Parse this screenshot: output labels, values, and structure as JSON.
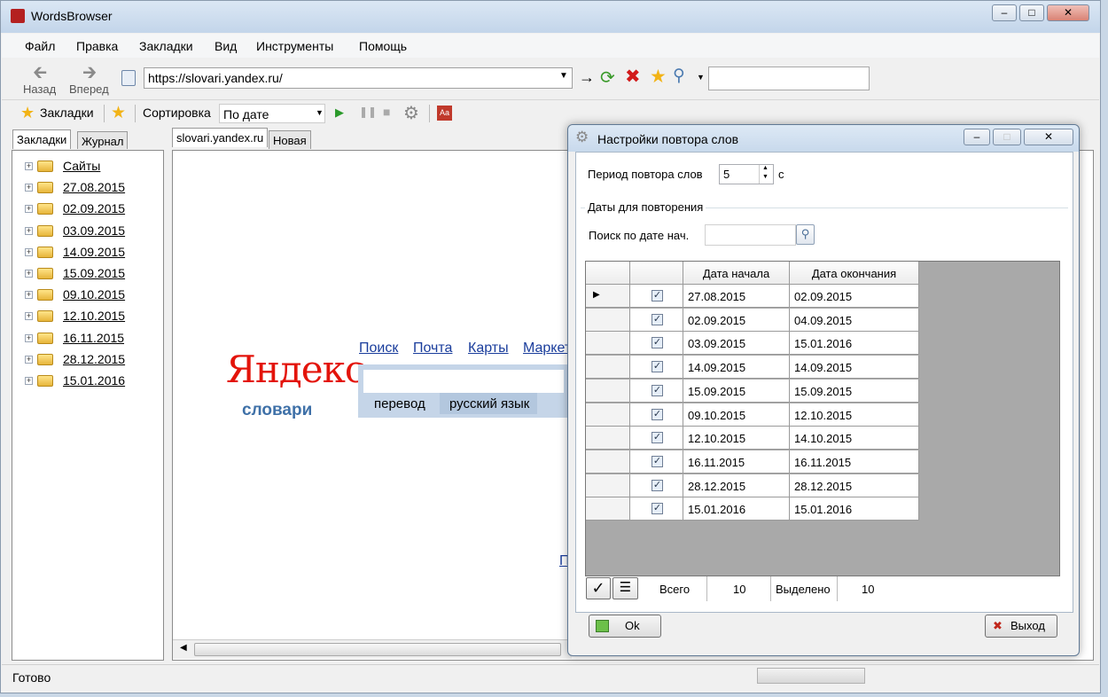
{
  "app": {
    "title": "WordsBrowser"
  },
  "menu": [
    "Файл",
    "Правка",
    "Закладки",
    "Вид",
    "Инструменты",
    "Помощь"
  ],
  "nav": {
    "back_label": "Назад",
    "forward_label": "Вперед",
    "url": "https://slovari.yandex.ru/",
    "arrow_glyph": "→"
  },
  "bookmarks_bar": {
    "bookmarks_label": "Закладки",
    "sort_label": "Сортировка",
    "sort_value": "По дате"
  },
  "left_tabs": [
    "Закладки",
    "Журнал"
  ],
  "tree": {
    "items": [
      "Сайты",
      "27.08.2015",
      "02.09.2015",
      "03.09.2015",
      "14.09.2015",
      "15.09.2015",
      "09.10.2015",
      "12.10.2015",
      "16.11.2015",
      "28.12.2015",
      "15.01.2016"
    ]
  },
  "browser_tabs": [
    "slovari.yandex.ru",
    "Новая"
  ],
  "page": {
    "logo_top": "Яндекс",
    "logo_bottom": "словари",
    "links": [
      "Поиск",
      "Почта",
      "Карты",
      "Маркет"
    ],
    "pill_left": "перевод",
    "pill_right": "русский язык",
    "partial_link": "П"
  },
  "status": {
    "text": "Готово"
  },
  "dialog": {
    "title": "Настройки повтора слов",
    "period_label": "Период повтора слов",
    "period_value": "5",
    "period_unit": "с",
    "group_label": "Даты для повторения",
    "search_label": "Поиск по дате нач.",
    "search_value": "",
    "columns": [
      "Дата начала",
      "Дата окончания"
    ],
    "rows": [
      {
        "checked": true,
        "start": "27.08.2015",
        "end": "02.09.2015"
      },
      {
        "checked": true,
        "start": "02.09.2015",
        "end": "04.09.2015"
      },
      {
        "checked": true,
        "start": "03.09.2015",
        "end": "15.01.2016"
      },
      {
        "checked": true,
        "start": "14.09.2015",
        "end": "14.09.2015"
      },
      {
        "checked": true,
        "start": "15.09.2015",
        "end": "15.09.2015"
      },
      {
        "checked": true,
        "start": "09.10.2015",
        "end": "12.10.2015"
      },
      {
        "checked": true,
        "start": "12.10.2015",
        "end": "14.10.2015"
      },
      {
        "checked": true,
        "start": "16.11.2015",
        "end": "16.11.2015"
      },
      {
        "checked": true,
        "start": "28.12.2015",
        "end": "28.12.2015"
      },
      {
        "checked": true,
        "start": "15.01.2016",
        "end": "15.01.2016"
      }
    ],
    "footer": {
      "total_label": "Всего",
      "total_value": "10",
      "selected_label": "Выделено",
      "selected_value": "10"
    },
    "ok_label": "Ok",
    "exit_label": "Выход"
  },
  "colors": {
    "accent": "#1a3d9c",
    "yandex_red": "#e3140b",
    "slovari_blue": "#3f71a8"
  }
}
